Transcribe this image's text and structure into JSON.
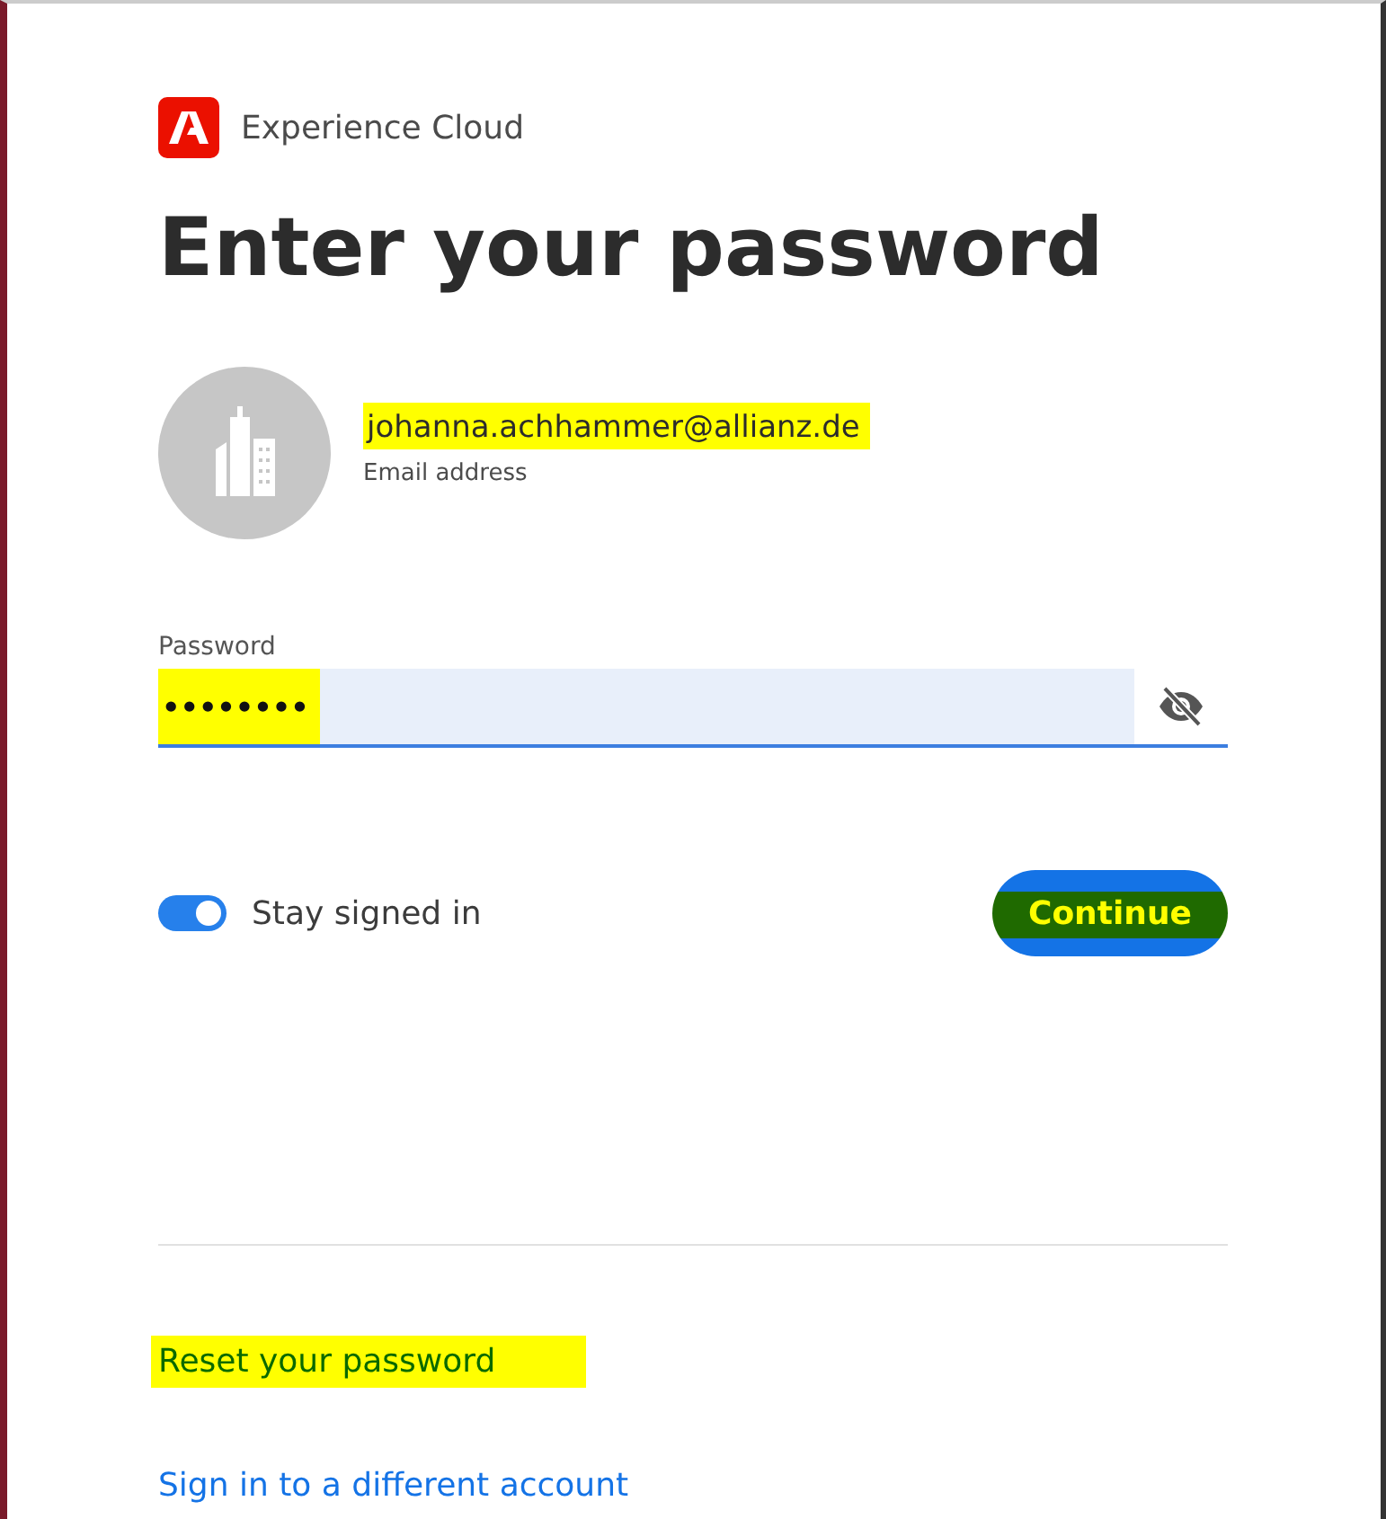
{
  "brand": {
    "name": "Experience Cloud"
  },
  "title": "Enter your password",
  "account": {
    "email": "johanna.achhammer@allianz.de",
    "email_highlighted": true,
    "caption": "Email address"
  },
  "password": {
    "label": "Password",
    "value": "••••••••",
    "highlighted": true
  },
  "stay_signed_in": {
    "label": "Stay signed in",
    "on": true
  },
  "continue_button": {
    "label": "Continue",
    "highlighted": true
  },
  "links": [
    {
      "label": "Reset your password",
      "highlighted": true
    },
    {
      "label": "Sign in to a different account",
      "highlighted": false
    }
  ]
}
